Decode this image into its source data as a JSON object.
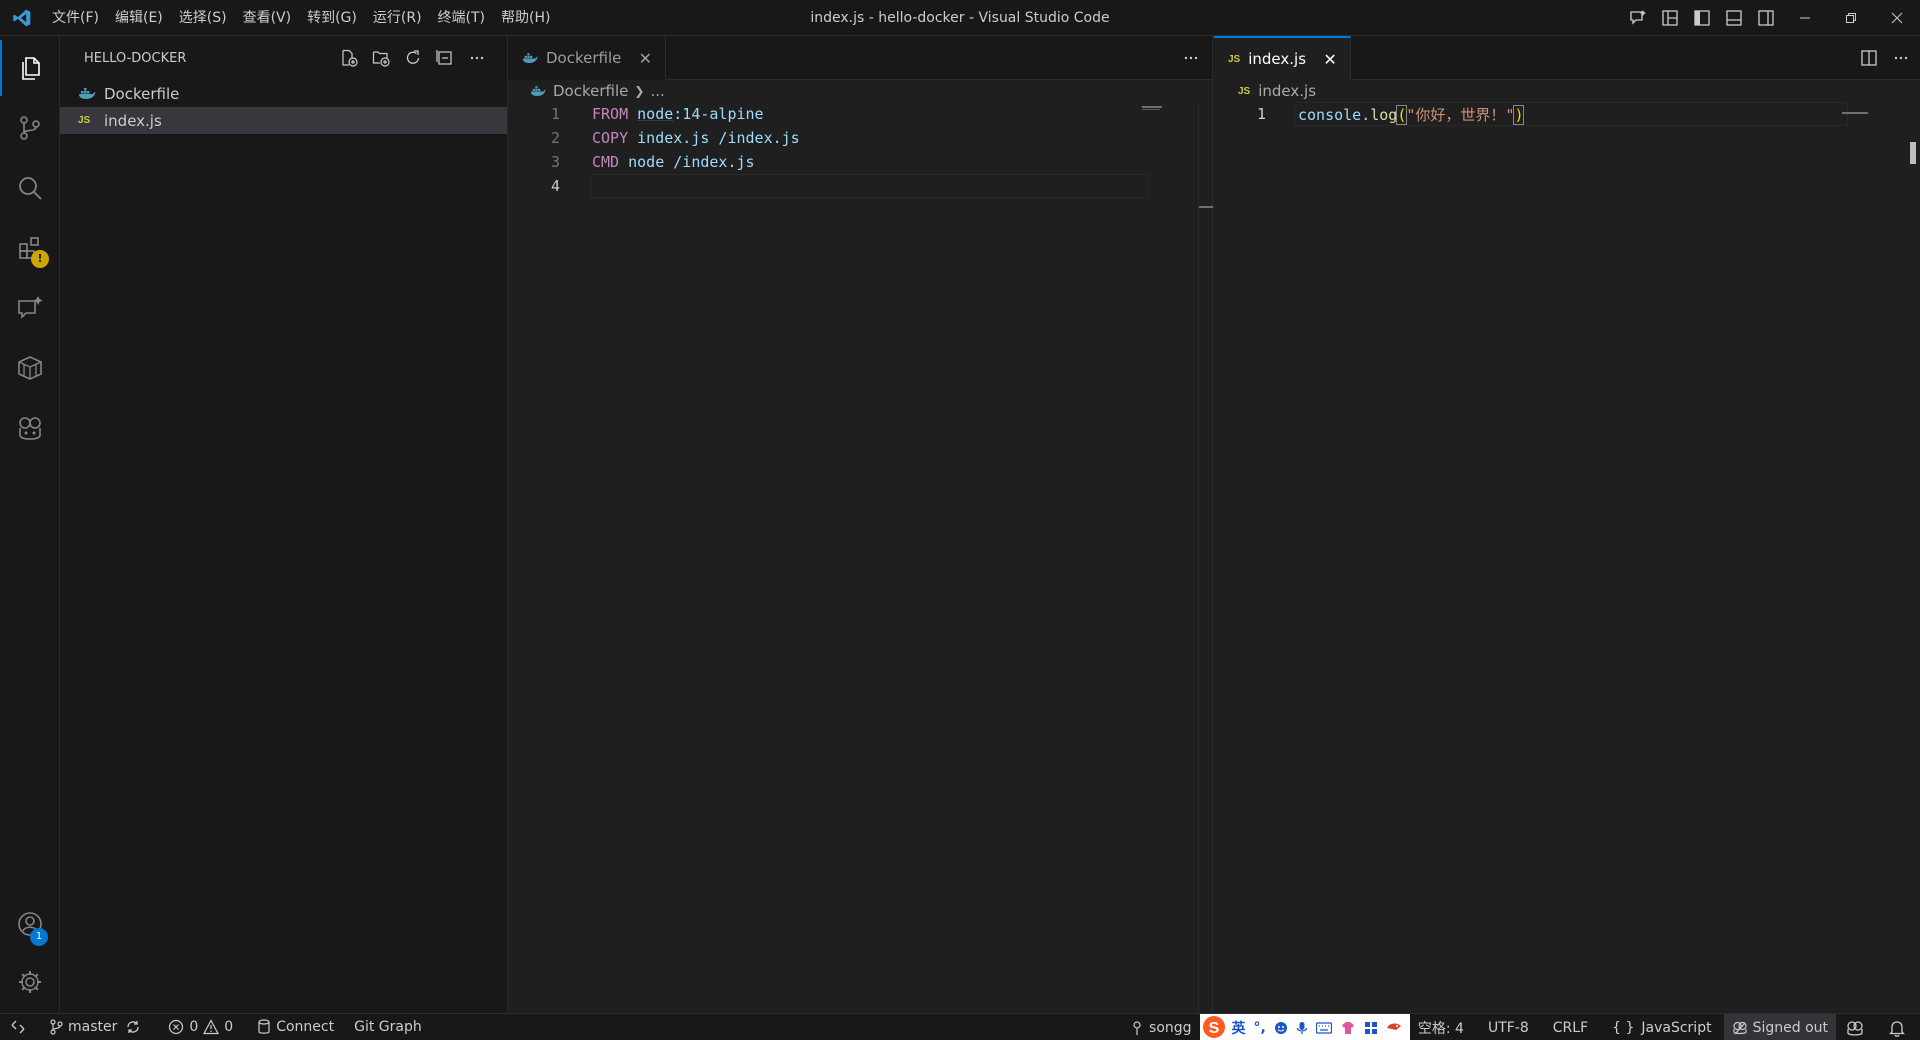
{
  "window": {
    "title": "index.js - hello-docker - Visual Studio Code",
    "menu": [
      "文件(F)",
      "编辑(E)",
      "选择(S)",
      "查看(V)",
      "转到(G)",
      "运行(R)",
      "终端(T)",
      "帮助(H)"
    ]
  },
  "activity_bar": {
    "items": [
      "explorer-icon",
      "source-control-icon",
      "search-icon",
      "extensions-icon",
      "chat-icon",
      "docker-icon",
      "copilot-icon"
    ],
    "accounts_badge": "1"
  },
  "sidebar": {
    "title": "HELLO-DOCKER",
    "files": [
      {
        "name": "Dockerfile",
        "icon": "docker-icon"
      },
      {
        "name": "index.js",
        "icon": "js-icon",
        "icon_text": "JS"
      }
    ]
  },
  "editor_left": {
    "tab": {
      "label": "Dockerfile",
      "close": "✕"
    },
    "more": "···",
    "breadcrumb": {
      "file": "Dockerfile",
      "rest": "..."
    },
    "line_numbers": [
      "1",
      "2",
      "3",
      "4"
    ],
    "lines": [
      {
        "kw": "FROM",
        "id": "node",
        "rest": ":14-alpine"
      },
      {
        "kw": "COPY",
        "rest": "index.js /index.js"
      },
      {
        "kw": "CMD",
        "rest": "node /index.js"
      }
    ]
  },
  "editor_right": {
    "tab": {
      "label": "index.js",
      "icon_text": "JS",
      "close": "✕"
    },
    "more": "···",
    "breadcrumb": {
      "file": "index.js",
      "icon_text": "JS"
    },
    "line_numbers": [
      "1"
    ],
    "code": {
      "obj": "console",
      "dot": ".",
      "fn": "log",
      "open": "(",
      "str": "\"你好，世界！\"",
      "close": ")"
    }
  },
  "status_bar": {
    "branch": "master",
    "errors": "0",
    "warnings": "0",
    "connect": "Connect",
    "git_graph": "Git Graph",
    "user": "songg",
    "ime_lang": "英",
    "ime_punct": "°,",
    "spaces": "空格: 4",
    "encoding": "UTF-8",
    "eol": "CRLF",
    "lang_braces": "{ }",
    "language": "JavaScript",
    "signed_out": "Signed out"
  },
  "colors": {
    "accent": "#0078d4",
    "keyword": "#c586c0",
    "identifier": "#9cdcfe",
    "string": "#ce9178",
    "function": "#dcdcaa",
    "js_icon": "#cbcb41",
    "docker_icon": "#519aba"
  }
}
